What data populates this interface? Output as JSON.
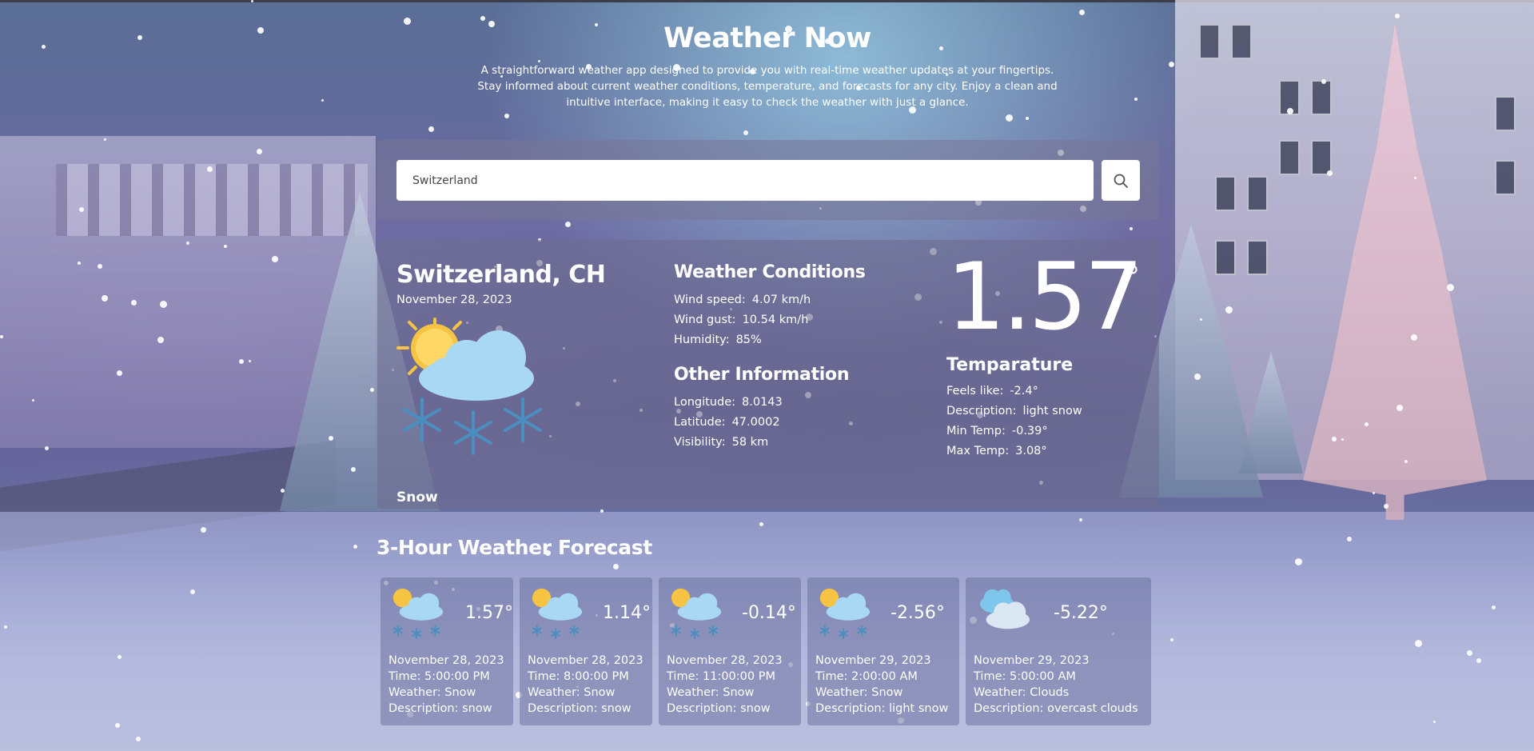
{
  "header": {
    "title": "Weather Now",
    "subtitle": "A straightforward weather app designed to provide you with real-time weather updates at your fingertips. Stay informed about current weather conditions, temperature, and forecasts for any city. Enjoy a clean and intuitive interface, making it easy to check the weather with just a glance."
  },
  "search": {
    "value": "Switzerland",
    "button_icon": "search-icon"
  },
  "current": {
    "location": "Switzerland, CH",
    "date": "November 28, 2023",
    "icon": "sun-cloud-snow-icon",
    "condition": "Snow",
    "weather_conditions": {
      "title": "Weather Conditions",
      "rows": [
        {
          "label": "Wind speed:",
          "value": "4.07 km/h"
        },
        {
          "label": "Wind gust:",
          "value": "10.54 km/h"
        },
        {
          "label": "Humidity:",
          "value": "85%"
        }
      ]
    },
    "other_information": {
      "title": "Other Information",
      "rows": [
        {
          "label": "Longitude:",
          "value": "8.0143"
        },
        {
          "label": "Latitude:",
          "value": "47.0002"
        },
        {
          "label": "Visibility:",
          "value": "58 km"
        }
      ]
    },
    "temperature": {
      "value": "1.57",
      "degree": "°",
      "title": "Temparature",
      "rows": [
        {
          "label": "Feels like:",
          "value": "-2.4°"
        },
        {
          "label": "Description:",
          "value": "light snow"
        },
        {
          "label": "Min Temp:",
          "value": "-0.39°"
        },
        {
          "label": "Max Temp:",
          "value": "3.08°"
        }
      ]
    }
  },
  "forecast": {
    "title": "3-Hour Weather Forecast",
    "items": [
      {
        "icon": "sun-cloud-snow-icon",
        "temp": "1.57°",
        "date": "November 28, 2023",
        "time": "Time: 5:00:00 PM",
        "weather": "Weather: Snow",
        "description": "Description: snow"
      },
      {
        "icon": "sun-cloud-snow-icon",
        "temp": "1.14°",
        "date": "November 28, 2023",
        "time": "Time: 8:00:00 PM",
        "weather": "Weather: Snow",
        "description": "Description: snow"
      },
      {
        "icon": "sun-cloud-snow-icon",
        "temp": "-0.14°",
        "date": "November 28, 2023",
        "time": "Time: 11:00:00 PM",
        "weather": "Weather: Snow",
        "description": "Description: snow"
      },
      {
        "icon": "sun-cloud-snow-icon",
        "temp": "-2.56°",
        "date": "November 29, 2023",
        "time": "Time: 2:00:00 AM",
        "weather": "Weather: Snow",
        "description": "Description: light snow"
      },
      {
        "icon": "clouds-icon",
        "temp": "-5.22°",
        "date": "November 29, 2023",
        "time": "Time: 5:00:00 AM",
        "weather": "Weather: Clouds",
        "description": "Description: overcast clouds"
      }
    ]
  },
  "colors": {
    "sun": "#f6c343",
    "cloud": "#a9d8f5",
    "snowflake": "#4a8fbf",
    "panel": "#6e6e91"
  }
}
